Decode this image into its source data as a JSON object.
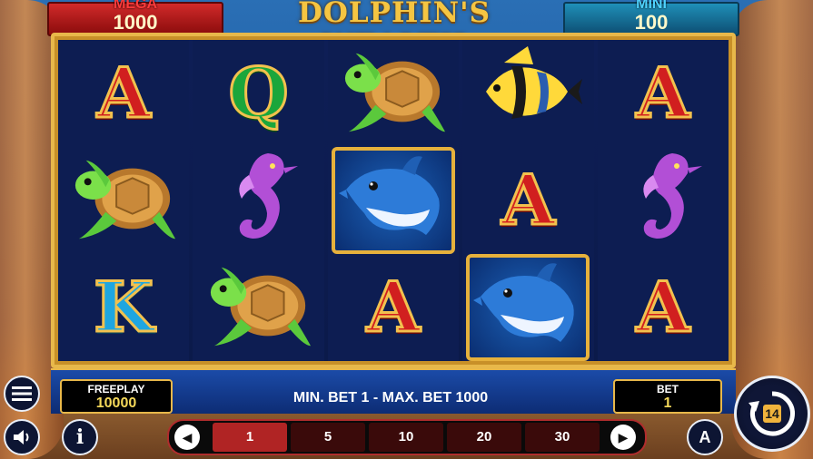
{
  "game": {
    "title": "DOLPHIN'S WEALTH"
  },
  "jackpots": {
    "mega": {
      "label": "MEGA",
      "value": "1000"
    },
    "mini": {
      "label": "MINI",
      "value": "100"
    }
  },
  "reels": [
    [
      "A",
      "turtle",
      "K"
    ],
    [
      "Q",
      "seahorse",
      "turtle"
    ],
    [
      "turtle",
      "dolphin",
      "A"
    ],
    [
      "fish",
      "A",
      "dolphin"
    ],
    [
      "A",
      "seahorse",
      "A"
    ]
  ],
  "freeplay": {
    "label": "FREEPLAY",
    "value": "10000"
  },
  "bet_range": "MIN. BET 1 - MAX. BET 1000",
  "bet": {
    "label": "BET",
    "value": "1"
  },
  "bet_options": [
    "1",
    "5",
    "10",
    "20",
    "30"
  ],
  "selected_bet": "1",
  "controls": {
    "menu_icon": "menu-icon",
    "sound_icon": "sound-icon",
    "info_icon": "info-icon",
    "autoplay_icon": "autoplay-icon",
    "spin_icon": "spin-icon"
  }
}
